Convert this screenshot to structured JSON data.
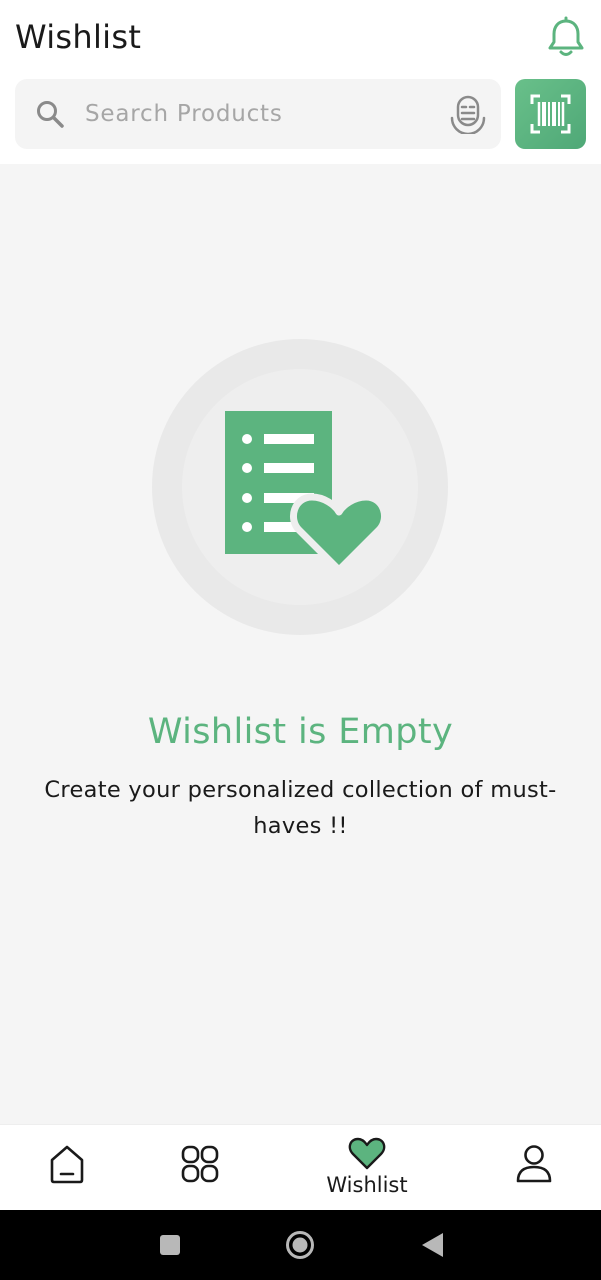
{
  "header": {
    "title": "Wishlist",
    "bell_icon": "bell-icon"
  },
  "search": {
    "placeholder": "Search Products",
    "value": "",
    "search_icon": "search-icon",
    "voice_icon": "voice-search-icon",
    "scan_icon": "barcode-scan-icon"
  },
  "empty_state": {
    "illustration_icon": "wishlist-list-heart-icon",
    "title": "Wishlist is Empty",
    "subtitle": "Create your personalized collection of must-haves !!"
  },
  "bottom_nav": {
    "items": [
      {
        "id": "home",
        "icon": "home-icon",
        "label": "",
        "active": false
      },
      {
        "id": "categories",
        "icon": "categories-grid-icon",
        "label": "",
        "active": false
      },
      {
        "id": "wishlist",
        "icon": "heart-icon",
        "label": "Wishlist",
        "active": true
      },
      {
        "id": "profile",
        "icon": "user-icon",
        "label": "",
        "active": false
      }
    ]
  },
  "system_nav": {
    "buttons": [
      "recents-square-icon",
      "home-circle-icon",
      "back-triangle-icon"
    ]
  },
  "colors": {
    "accent": "#5cb47f",
    "text": "#1a1a1a",
    "background": "#f5f5f5",
    "search_bg": "#f4f4f4",
    "placeholder": "#a6a6a6"
  }
}
